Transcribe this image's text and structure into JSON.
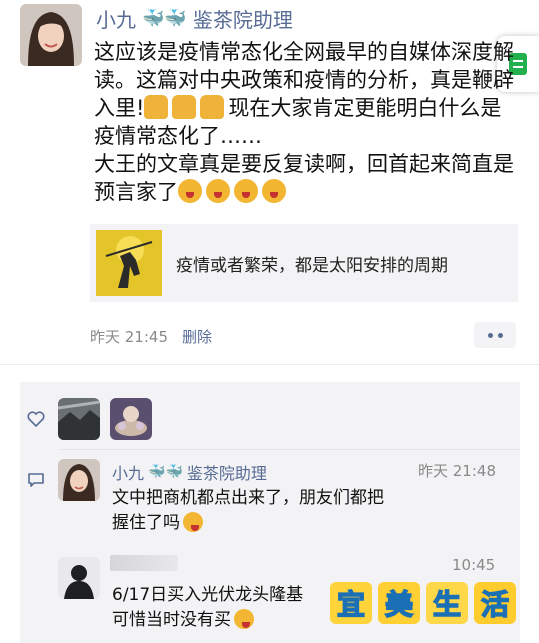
{
  "post": {
    "author": "小九",
    "author_suffix": "鉴茶院助理",
    "paragraph1": "这应该是疫情常态化全网最早的自媒体深度解读。这篇对中央政策和疫情的分析，真是鞭辟入里!",
    "paragraph1_tail": "现在大家肯定更能明白什么是疫情常态化了……",
    "paragraph2": "大王的文章真是要反复读啊，回首起来简直是预言家了",
    "link_title": "疫情或者繁荣，都是太阳安排的周期",
    "time": "昨天 21:45",
    "delete_label": "删除"
  },
  "comments": [
    {
      "author": "小九",
      "author_suffix": "鉴茶院助理",
      "time": "昨天 21:48",
      "text_line1": "文中把商机都点出来了，朋友们都把",
      "text_line2": "握住了吗"
    },
    {
      "author": "",
      "time": "10:45",
      "text_line1": "6/17日买入光伏龙头隆基",
      "text_line2": "可惜当时没有买"
    }
  ],
  "watermark": [
    "宜",
    "美",
    "生",
    "活"
  ],
  "colors": {
    "link": "#576b95",
    "meta": "#8a8a8a",
    "card_bg": "#f3f3f5"
  },
  "icons": {
    "fish": "whale-emoji",
    "like": "heart-icon",
    "comment": "comment-icon"
  }
}
